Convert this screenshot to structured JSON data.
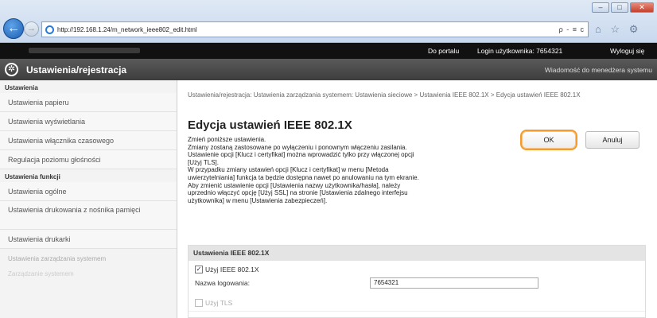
{
  "browser": {
    "url": "http://192.168.1.24/m_network_ieee802_edit.html",
    "address_tools": "ρ - ≡ c",
    "toolbar_icons": "⌂ ☆ ⚙"
  },
  "header": {
    "portal_link": "Do portalu",
    "login_label": "Login użytkownika:  7654321",
    "logout_link": "Wyloguj się",
    "app_title": "Ustawienia/rejestracja",
    "admin_message": "Wiadomość do menedżera systemu"
  },
  "sidebar": {
    "section1": "Ustawienia",
    "items1": [
      "Ustawienia papieru",
      "Ustawienia wyświetlania",
      "Ustawienia włącznika czasowego",
      "Regulacja poziomu głośności"
    ],
    "section2": "Ustawienia funkcji",
    "items2": [
      "Ustawienia ogólne",
      "Ustawienia drukowania z nośnika pamięci",
      "Ustawienia drukarki"
    ],
    "section3": "Ustawienia zarządzania systemem",
    "section3_sub": "Zarządzanie systemem"
  },
  "main": {
    "breadcrumb": "Ustawienia/rejestracja: Ustawienia zarządzania systemem: Ustawienia sieciowe > Ustawienia IEEE 802.1X > Edycja ustawień IEEE 802.1X",
    "title": "Edycja ustawień IEEE 802.1X",
    "description_lines": [
      "Zmień poniższe ustawienia.",
      "Zmiany zostaną zastosowane po wyłączeniu i ponownym włączeniu zasilania.",
      "Ustawienie opcji [Klucz i certyfikat] można wprowadzić tylko przy włączonej opcji",
      "[Użyj TLS].",
      "W przypadku zmiany ustawień opcji [Klucz i certyfikat] w menu [Metoda",
      "uwierzytelniania] funkcja ta będzie dostępna nawet po anulowaniu na tym ekranie.",
      "Aby zmienić ustawienie opcji [Ustawienia nazwy użytkownika/hasła], należy",
      "uprzednio włączyć opcję [Użyj SSL] na stronie [Ustawienia zdalnego interfejsu",
      "użytkownika] w menu [Ustawienia zabezpieczeń]."
    ],
    "ok_label": "OK",
    "cancel_label": "Anuluj",
    "panel_title": "Ustawienia IEEE 802.1X",
    "use_ieee_label": "Użyj IEEE 802.1X",
    "use_ieee_checked": "✓",
    "login_name_label": "Nazwa logowania:",
    "login_name_value": "7654321",
    "use_tls_label": "Użyj TLS"
  }
}
